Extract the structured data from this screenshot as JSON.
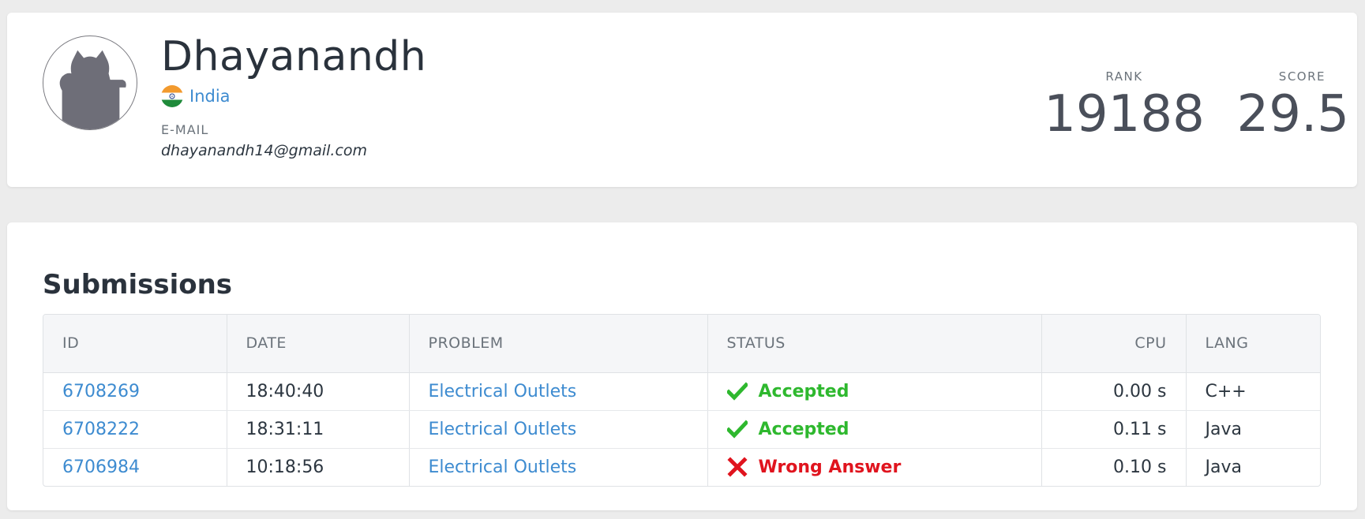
{
  "profile": {
    "name": "Dhayanandh",
    "country": "India",
    "email_label": "E-MAIL",
    "email": "dhayanandh14@gmail.com",
    "rank_label": "RANK",
    "rank": "19188",
    "score_label": "SCORE",
    "score": "29.5",
    "avatar_icon": "default-avatar-icon",
    "flag_icon": "india-flag-icon"
  },
  "submissions": {
    "title": "Submissions",
    "columns": [
      "ID",
      "DATE",
      "PROBLEM",
      "STATUS",
      "CPU",
      "LANG"
    ],
    "rows": [
      {
        "id": "6708269",
        "date": "18:40:40",
        "problem": "Electrical Outlets",
        "status": "Accepted",
        "status_type": "accepted",
        "status_icon": "checkmark-icon",
        "cpu": "0.00 s",
        "lang": "C++"
      },
      {
        "id": "6708222",
        "date": "18:31:11",
        "problem": "Electrical Outlets",
        "status": "Accepted",
        "status_type": "accepted",
        "status_icon": "checkmark-icon",
        "cpu": "0.11 s",
        "lang": "Java"
      },
      {
        "id": "6706984",
        "date": "10:18:56",
        "problem": "Electrical Outlets",
        "status": "Wrong Answer",
        "status_type": "wrong",
        "status_icon": "cross-icon",
        "cpu": "0.10 s",
        "lang": "Java"
      }
    ]
  },
  "colors": {
    "link": "#3d8bd0",
    "accepted": "#2eb82e",
    "wrong": "#e0141e",
    "background": "#ececec"
  }
}
